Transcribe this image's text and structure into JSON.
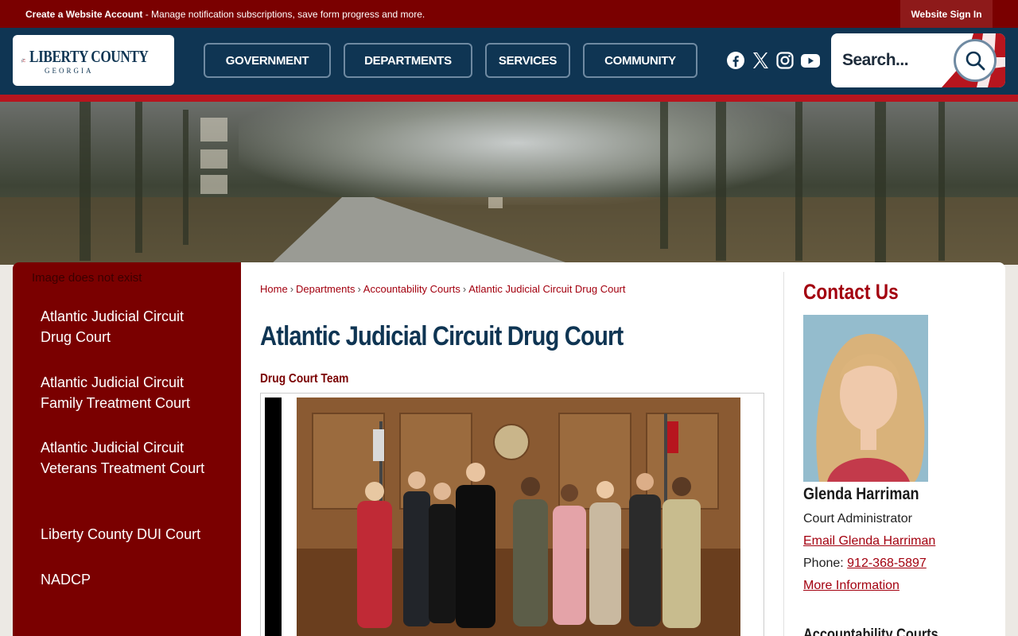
{
  "topbar": {
    "notice_bold": "Create a Website Account",
    "notice_rest": " - Manage notification subscriptions, save form progress and more.",
    "signin_label": "Website Sign In"
  },
  "logo": {
    "name": "LIBERTY COUNTY",
    "state": "GEORGIA"
  },
  "nav": [
    {
      "label": "GOVERNMENT"
    },
    {
      "label": "DEPARTMENTS"
    },
    {
      "label": "SERVICES"
    },
    {
      "label": "COMMUNITY"
    }
  ],
  "social": [
    "facebook-icon",
    "x-icon",
    "instagram-icon",
    "youtube-icon"
  ],
  "search": {
    "placeholder": "Search..."
  },
  "sidebar": {
    "missing_image": "Image does not exist",
    "items": [
      {
        "label": "Atlantic Judicial Circuit Drug Court"
      },
      {
        "label": "Atlantic Judicial Circuit Family Treatment Court"
      },
      {
        "label": "Atlantic Judicial Circuit Veterans Treatment Court"
      },
      {
        "label": "Liberty County DUI Court"
      },
      {
        "label": "NADCP"
      }
    ]
  },
  "breadcrumb": [
    "Home",
    "Departments",
    "Accountability Courts",
    "Atlantic Judicial Circuit Drug Court"
  ],
  "page": {
    "title": "Atlantic Judicial Circuit Drug Court",
    "subheading": "Drug Court Team"
  },
  "contact": {
    "heading": "Contact Us",
    "name": "Glenda Harriman",
    "role": "Court Administrator",
    "email_label": "Email Glenda Harriman",
    "phone_label": "Phone: ",
    "phone": "912-368-5897",
    "more_label": "More Information"
  },
  "related": {
    "heading": "Accountability Courts"
  },
  "colors": {
    "brand_red": "#7a0000",
    "navy": "#0f3553",
    "link_red": "#a3000f",
    "accent_red": "#b7151e"
  }
}
